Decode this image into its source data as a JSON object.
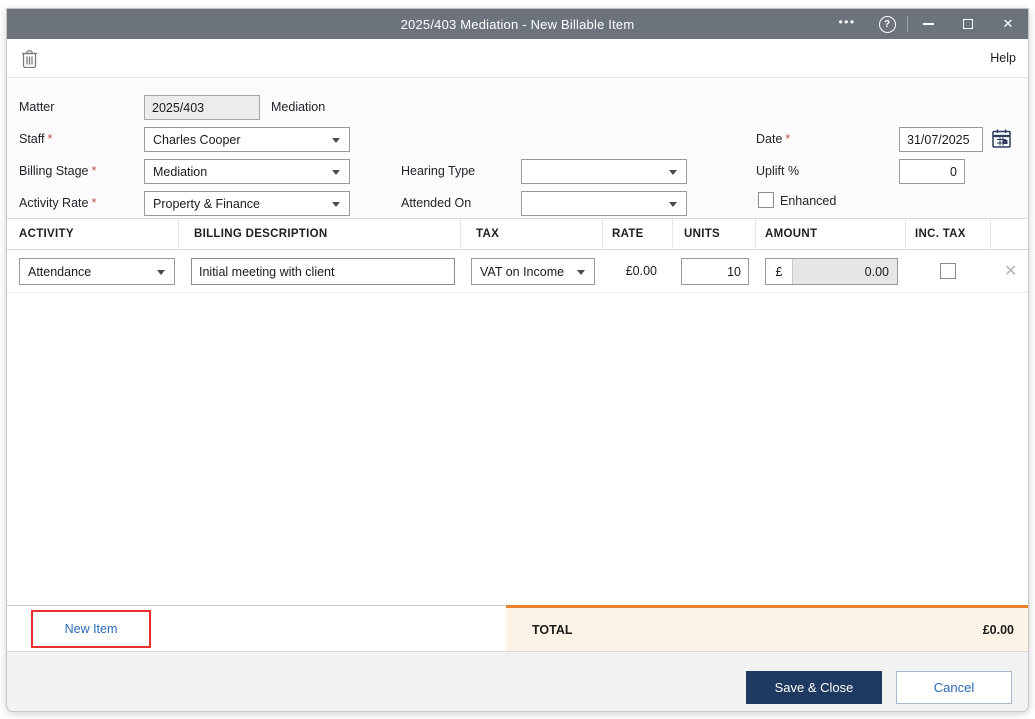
{
  "window": {
    "title": "2025/403 Mediation - New Billable Item",
    "controls": {
      "more": "•••",
      "help": "?",
      "close": "✕"
    }
  },
  "toolbar": {
    "help_label": "Help"
  },
  "form": {
    "matter": {
      "label": "Matter",
      "value": "2025/403",
      "suffix": "Mediation"
    },
    "staff": {
      "label": "Staff",
      "required": "*",
      "value": "Charles Cooper"
    },
    "billing_stage": {
      "label": "Billing Stage",
      "required": "*",
      "value": "Mediation"
    },
    "activity_rate": {
      "label": "Activity Rate",
      "required": "*",
      "value": "Property & Finance"
    },
    "hearing_type": {
      "label": "Hearing Type",
      "value": ""
    },
    "attended_on": {
      "label": "Attended On",
      "value": ""
    },
    "date": {
      "label": "Date",
      "required": "*",
      "value": "31/07/2025"
    },
    "uplift": {
      "label": "Uplift %",
      "value": "0"
    },
    "enhanced": {
      "label": "Enhanced",
      "checked": false
    }
  },
  "table": {
    "headers": [
      "ACTIVITY",
      "BILLING DESCRIPTION",
      "TAX",
      "RATE",
      "UNITS",
      "AMOUNT",
      "INC. TAX"
    ],
    "rows": [
      {
        "activity": "Attendance",
        "description": "Initial meeting with client",
        "tax": "VAT on Income",
        "rate": "£0.00",
        "units": "10",
        "currency": "£",
        "amount": "0.00",
        "inc_tax": false,
        "delete_glyph": "✕"
      }
    ]
  },
  "footer": {
    "new_item_label": "New Item",
    "total_label": "TOTAL",
    "total_value": "£0.00",
    "save_label": "Save & Close",
    "cancel_label": "Cancel"
  },
  "colors": {
    "titlebar": "#6d737d",
    "accent_orange": "#e8822d",
    "total_background": "#fdf4e7",
    "primary_button": "#1f3a61",
    "link_blue": "#2b6cb8",
    "annotation_red": "#e8312d"
  }
}
